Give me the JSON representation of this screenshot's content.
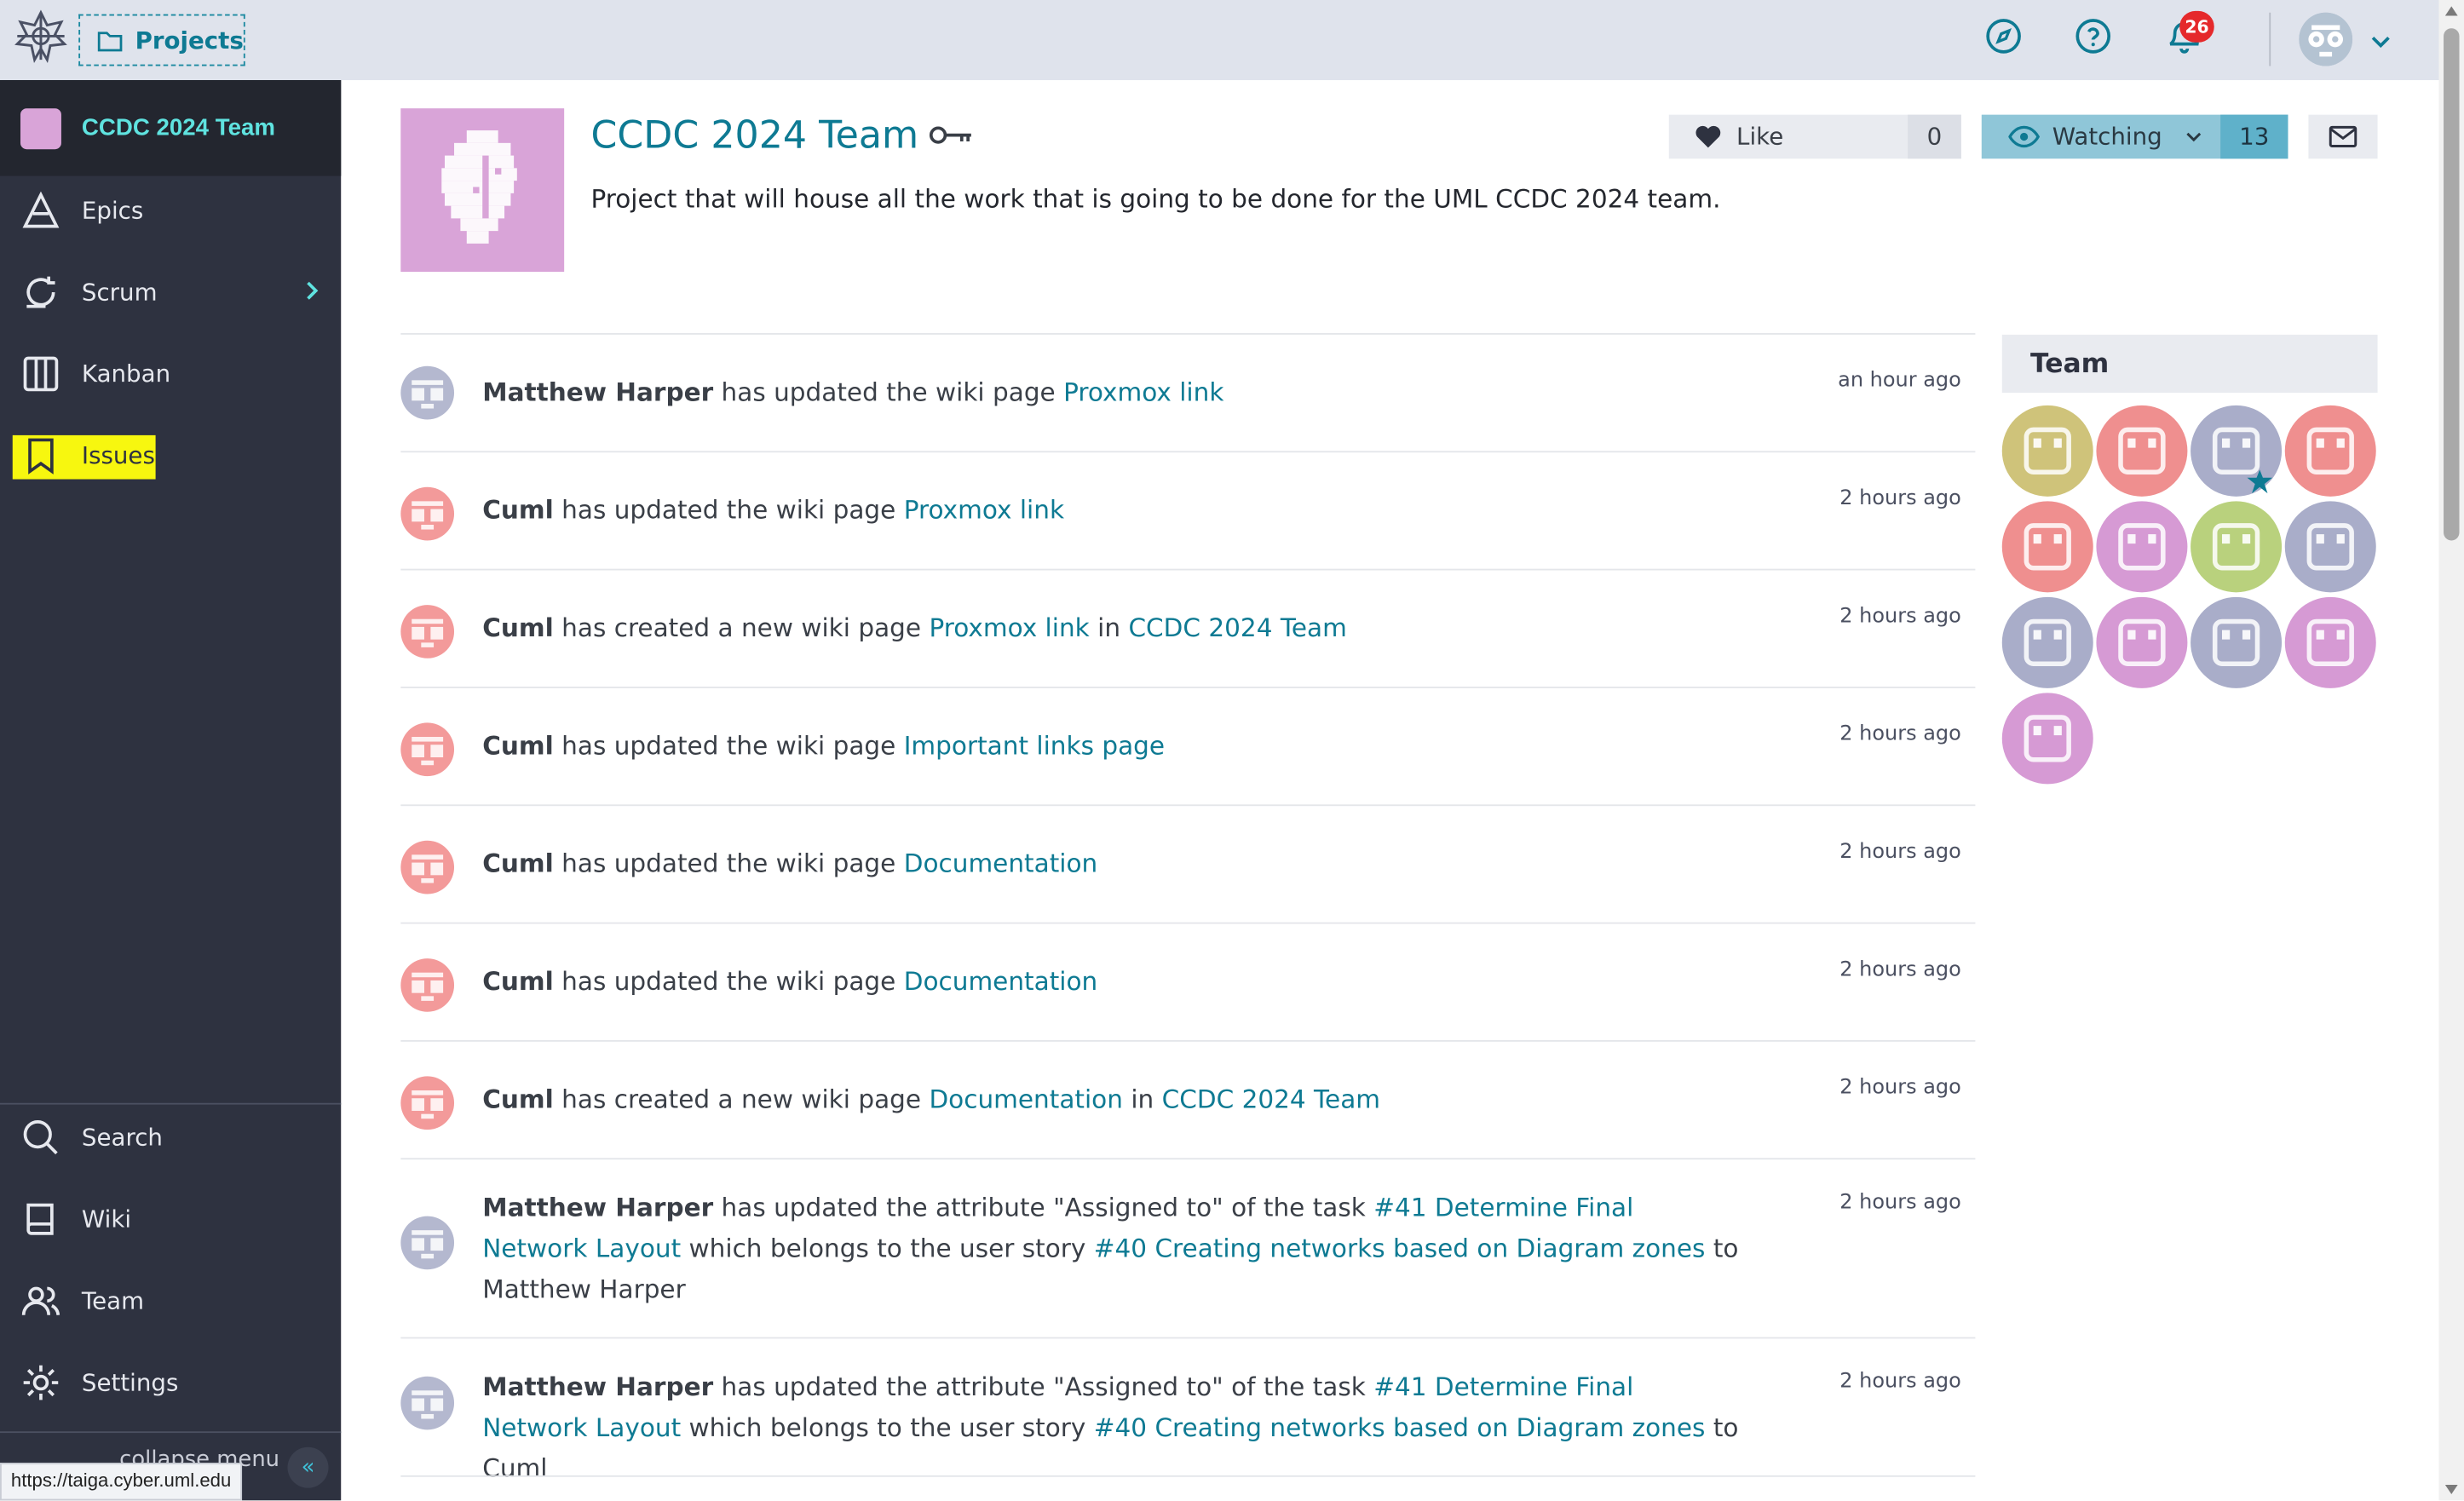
{
  "topbar": {
    "projects_label": "Projects",
    "notifications_count": "26",
    "icons": [
      "logo-icon",
      "folder-icon",
      "compass-icon",
      "help-icon",
      "bell-icon",
      "user-avatar",
      "chevron-down-icon"
    ]
  },
  "sidebar": {
    "project_name": "CCDC 2024 Team",
    "items": [
      {
        "label": "Epics",
        "icon": "epics-icon"
      },
      {
        "label": "Scrum",
        "icon": "scrum-icon"
      },
      {
        "label": "Kanban",
        "icon": "kanban-icon"
      },
      {
        "label": "Issues",
        "icon": "bookmark-icon"
      }
    ],
    "bottom_items": [
      {
        "label": "Search",
        "icon": "search-icon"
      },
      {
        "label": "Wiki",
        "icon": "wiki-icon"
      },
      {
        "label": "Team",
        "icon": "team-icon"
      },
      {
        "label": "Settings",
        "icon": "gear-icon"
      }
    ],
    "collapse_label": "collapse menu",
    "status_url": "https://taiga.cyber.uml.edu"
  },
  "project": {
    "title": "CCDC 2024 Team",
    "description": "Project that will house all the work that is going to be done for the UML CCDC 2024 team.",
    "like_label": "Like",
    "like_count": "0",
    "watch_label": "Watching",
    "watch_count": "13"
  },
  "timeline": [
    {
      "who": "Matthew Harper",
      "pre": "has updated the wiki page",
      "link": "Proxmox link",
      "mid": "",
      "link2": "",
      "post": "",
      "time": "an hour ago",
      "avatar": "matthew"
    },
    {
      "who": "Cuml",
      "pre": "has updated the wiki page",
      "link": "Proxmox link",
      "mid": "",
      "link2": "",
      "post": "",
      "time": "2 hours ago",
      "avatar": "cuml"
    },
    {
      "who": "Cuml",
      "pre": "has created a new wiki page",
      "link": "Proxmox link",
      "mid": "in",
      "link2": "CCDC 2024 Team",
      "post": "",
      "time": "2 hours ago",
      "avatar": "cuml"
    },
    {
      "who": "Cuml",
      "pre": "has updated the wiki page",
      "link": "Important links page",
      "mid": "",
      "link2": "",
      "post": "",
      "time": "2 hours ago",
      "avatar": "cuml"
    },
    {
      "who": "Cuml",
      "pre": "has updated the wiki page",
      "link": "Documentation",
      "mid": "",
      "link2": "",
      "post": "",
      "time": "2 hours ago",
      "avatar": "cuml"
    },
    {
      "who": "Cuml",
      "pre": "has updated the wiki page",
      "link": "Documentation",
      "mid": "",
      "link2": "",
      "post": "",
      "time": "2 hours ago",
      "avatar": "cuml"
    },
    {
      "who": "Cuml",
      "pre": "has created a new wiki page",
      "link": "Documentation",
      "mid": "in",
      "link2": "CCDC 2024 Team",
      "post": "",
      "time": "2 hours ago",
      "avatar": "cuml"
    },
    {
      "who": "Matthew Harper",
      "pre": "has updated the attribute \"Assigned to\" of the task",
      "link": "#41 Determine Final Network Layout",
      "mid": "which belongs to the user story",
      "link2": "#40 Creating networks based on Diagram zones",
      "post": "to Matthew Harper",
      "time": "2 hours ago",
      "avatar": "matthew"
    },
    {
      "who": "Matthew Harper",
      "pre": "has updated the attribute \"Assigned to\" of the task",
      "link": "#41 Determine Final Network Layout",
      "mid": "which belongs to the user story",
      "link2": "#40 Creating networks based on Diagram zones",
      "post": "to Cuml",
      "time": "2 hours ago",
      "avatar": "matthew"
    }
  ],
  "team": {
    "heading": "Team",
    "member_colors": [
      "#cfc37a",
      "#ef8f8f",
      "#a9adc9",
      "#ef8f8f",
      "#ef8f8f",
      "#d69ad4",
      "#b9d17d",
      "#a9adc9",
      "#a9adc9",
      "#d69ad4",
      "#a9adc9",
      "#d69ad4",
      "#d69ad4"
    ]
  },
  "colors": {
    "accent": "#0e7a93",
    "sidebar_bg": "#2e3240",
    "highlight": "#f7f70f",
    "badge": "#e5292b"
  }
}
